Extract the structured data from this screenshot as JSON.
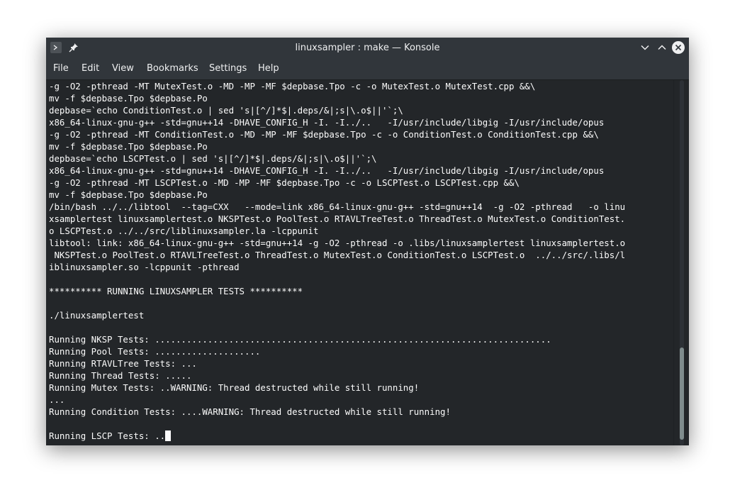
{
  "window": {
    "title": "linuxsampler : make — Konsole"
  },
  "titlebar": {
    "icons": {
      "app": "terminal-icon",
      "pin": "pin-icon",
      "minimize": "chevron-down-icon",
      "maximize": "chevron-up-icon",
      "close": "close-icon"
    }
  },
  "menubar": {
    "items": [
      {
        "label": "File"
      },
      {
        "label": "Edit"
      },
      {
        "label": "View"
      },
      {
        "label": "Bookmarks"
      },
      {
        "label": "Settings"
      },
      {
        "label": "Help"
      }
    ]
  },
  "terminal": {
    "lines": [
      "-g -O2 -pthread -MT MutexTest.o -MD -MP -MF $depbase.Tpo -c -o MutexTest.o MutexTest.cpp &&\\",
      "mv -f $depbase.Tpo $depbase.Po",
      "depbase=`echo ConditionTest.o | sed 's|[^/]*$|.deps/&|;s|\\.o$||'`;\\",
      "x86_64-linux-gnu-g++ -std=gnu++14 -DHAVE_CONFIG_H -I. -I../..   -I/usr/include/libgig -I/usr/include/opus",
      "-g -O2 -pthread -MT ConditionTest.o -MD -MP -MF $depbase.Tpo -c -o ConditionTest.o ConditionTest.cpp &&\\",
      "mv -f $depbase.Tpo $depbase.Po",
      "depbase=`echo LSCPTest.o | sed 's|[^/]*$|.deps/&|;s|\\.o$||'`;\\",
      "x86_64-linux-gnu-g++ -std=gnu++14 -DHAVE_CONFIG_H -I. -I../..   -I/usr/include/libgig -I/usr/include/opus",
      "-g -O2 -pthread -MT LSCPTest.o -MD -MP -MF $depbase.Tpo -c -o LSCPTest.o LSCPTest.cpp &&\\",
      "mv -f $depbase.Tpo $depbase.Po",
      "/bin/bash ../../libtool  --tag=CXX   --mode=link x86_64-linux-gnu-g++ -std=gnu++14  -g -O2 -pthread   -o linu",
      "xsamplertest linuxsamplertest.o NKSPTest.o PoolTest.o RTAVLTreeTest.o ThreadTest.o MutexTest.o ConditionTest.",
      "o LSCPTest.o ../../src/liblinuxsampler.la -lcppunit",
      "libtool: link: x86_64-linux-gnu-g++ -std=gnu++14 -g -O2 -pthread -o .libs/linuxsamplertest linuxsamplertest.o",
      " NKSPTest.o PoolTest.o RTAVLTreeTest.o ThreadTest.o MutexTest.o ConditionTest.o LSCPTest.o  ../../src/.libs/l",
      "iblinuxsampler.so -lcppunit -pthread",
      "",
      "********** RUNNING LINUXSAMPLER TESTS **********",
      "",
      "./linuxsamplertest",
      "",
      "Running NKSP Tests: ...........................................................................",
      "Running Pool Tests: ....................",
      "Running RTAVLTree Tests: ...",
      "Running Thread Tests: .....",
      "Running Mutex Tests: ..WARNING: Thread destructed while still running!",
      "...",
      "Running Condition Tests: ....WARNING: Thread destructed while still running!",
      "",
      "Running LSCP Tests: .."
    ]
  },
  "colors": {
    "background": "#232629",
    "foreground": "#fcfcfc",
    "titlebar": "#31363b"
  }
}
